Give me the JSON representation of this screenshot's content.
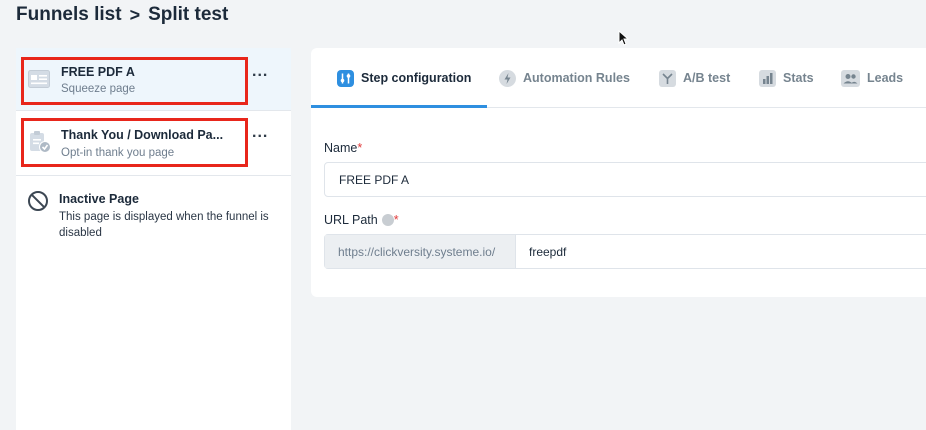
{
  "breadcrumb": {
    "root": "Funnels list",
    "separator": ">",
    "current": "Split test"
  },
  "sidebar": {
    "steps": [
      {
        "title": "FREE PDF A",
        "subtitle": "Squeeze page",
        "icon": "squeeze-page-icon",
        "more": "..."
      },
      {
        "title": "Thank You / Download Pa...",
        "subtitle": "Opt-in thank you page",
        "icon": "thank-you-page-icon",
        "more": "..."
      }
    ],
    "inactive": {
      "title": "Inactive Page",
      "description": "This page is displayed when the funnel is disabled",
      "icon": "inactive-circle-icon"
    }
  },
  "tabs": [
    {
      "label": "Step configuration",
      "icon": "sliders-icon",
      "active": true
    },
    {
      "label": "Automation Rules",
      "icon": "bolt-icon",
      "active": false
    },
    {
      "label": "A/B test",
      "icon": "split-icon",
      "active": false
    },
    {
      "label": "Stats",
      "icon": "bar-chart-icon",
      "active": false
    },
    {
      "label": "Leads",
      "icon": "users-icon",
      "active": false
    }
  ],
  "form": {
    "name_label": "Name",
    "required_mark": "*",
    "name_value": "FREE PDF A",
    "url_label": "URL Path",
    "url_prefix": "https://clickversity.systeme.io/",
    "url_value": "freepdf"
  },
  "colors": {
    "accent": "#2e8fe0",
    "highlight": "#e8261b",
    "required": "#e03a3a"
  }
}
